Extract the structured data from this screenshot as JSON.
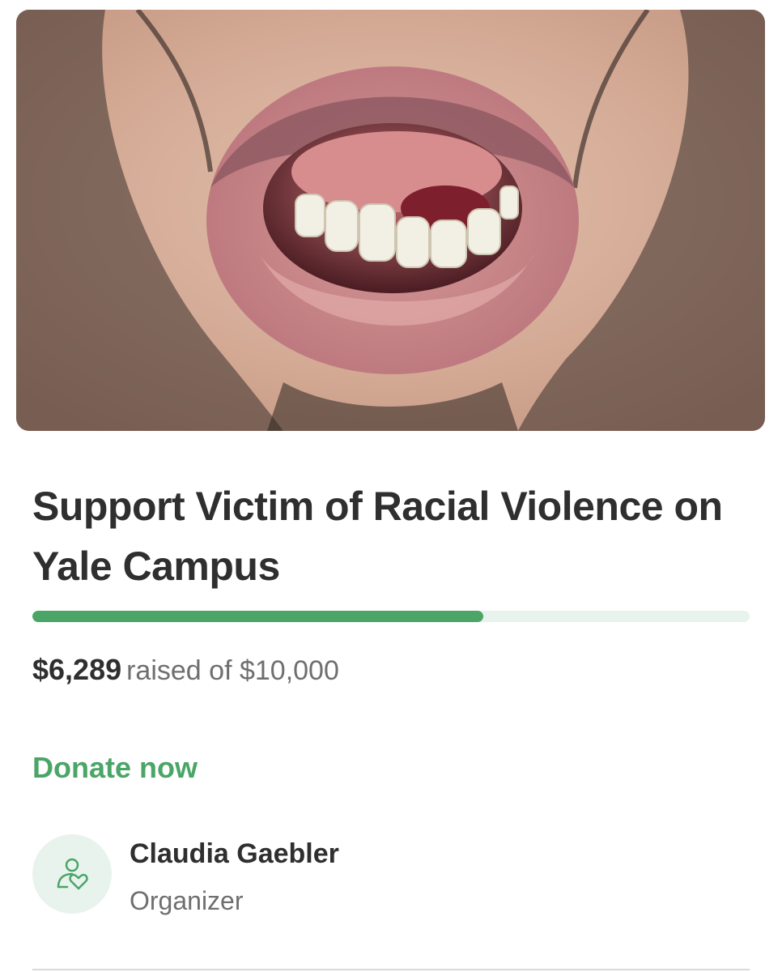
{
  "fundraiser": {
    "title": "Support Victim of Racial Violence on Yale Campus",
    "raised": "$6,289",
    "goal_text": "raised of $10,000",
    "progress_fraction": 0.629,
    "donate_label": "Donate now"
  },
  "organizer": {
    "name": "Claudia Gaebler",
    "role": "Organizer",
    "icon": "person-heart-icon"
  },
  "hero_image": {
    "icon": "photo-mouth-closeup"
  },
  "colors": {
    "accent": "#4aa567",
    "track": "#e9f3ee",
    "text": "#2f2f2f",
    "muted": "#6f6f6f"
  }
}
